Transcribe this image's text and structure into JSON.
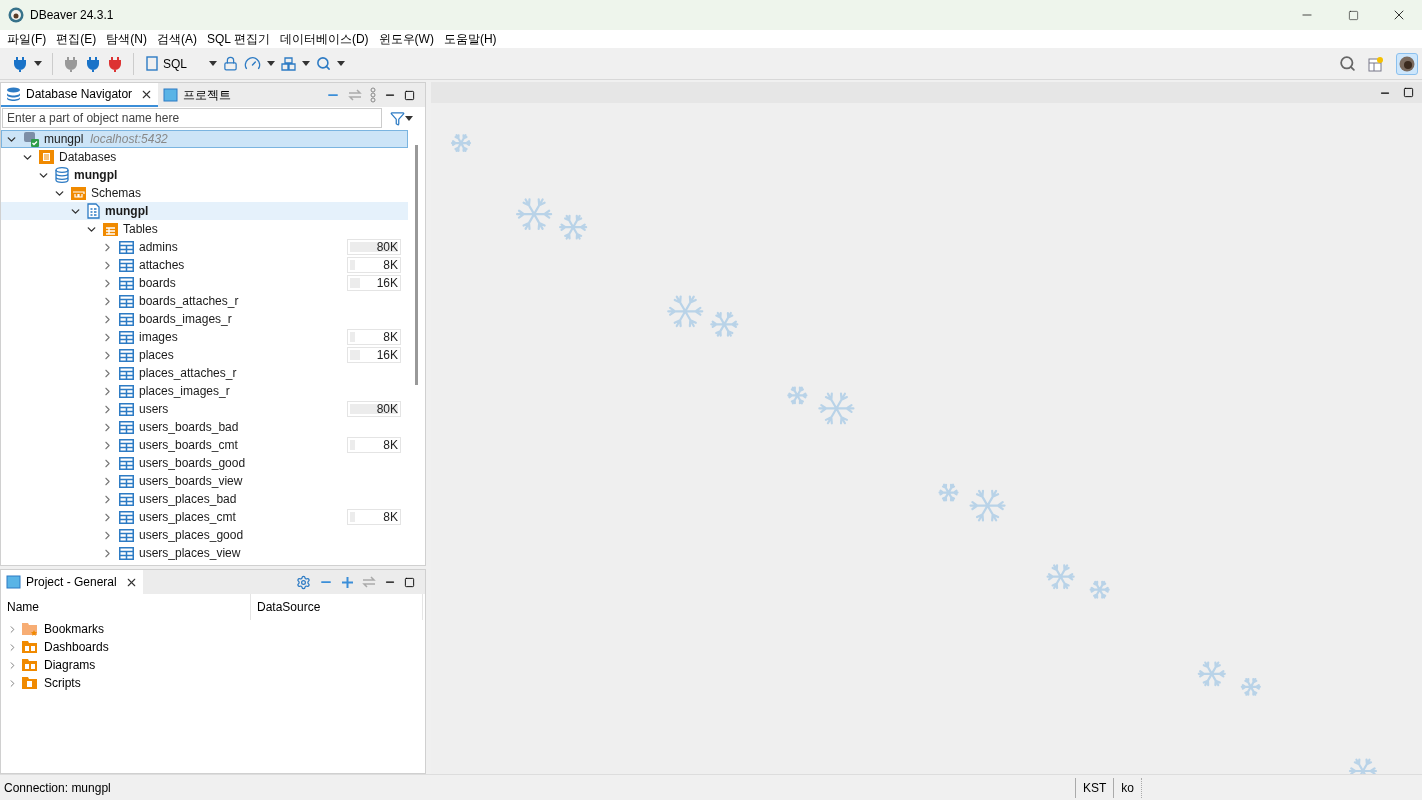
{
  "window": {
    "title": "DBeaver 24.3.1"
  },
  "menu": [
    "파일(F)",
    "편집(E)",
    "탐색(N)",
    "검색(A)",
    "SQL 편집기",
    "데이터베이스(D)",
    "윈도우(W)",
    "도움말(H)"
  ],
  "toolbar": {
    "sql_label": "SQL"
  },
  "navigator": {
    "tabs": [
      {
        "label": "Database Navigator",
        "selected": true
      },
      {
        "label": "프로젝트",
        "selected": false
      }
    ],
    "filter": {
      "placeholder": "Enter a part of object name here"
    },
    "tree": [
      {
        "kind": "connection",
        "label": "mungpl",
        "detail": "localhost:5432",
        "selected": true,
        "hovered": false,
        "expanded": true,
        "children": [
          {
            "kind": "folder",
            "label": "Databases",
            "selected": false,
            "hovered": false,
            "expanded": true,
            "children": [
              {
                "kind": "database",
                "label": "mungpl",
                "selected": false,
                "hovered": false,
                "expanded": true,
                "children": [
                  {
                    "kind": "schemas",
                    "label": "Schemas",
                    "selected": false,
                    "hovered": false,
                    "expanded": true,
                    "children": [
                      {
                        "kind": "schema",
                        "label": "mungpl",
                        "selected": false,
                        "hovered": true,
                        "expanded": true,
                        "children": [
                          {
                            "kind": "tables",
                            "label": "Tables",
                            "selected": false,
                            "hovered": false,
                            "expanded": true,
                            "children": [
                              {
                                "kind": "table",
                                "label": "admins",
                                "size": "80K",
                                "level": 1,
                                "selected": false,
                                "hovered": false,
                                "expanded": false
                              },
                              {
                                "kind": "table",
                                "label": "attaches",
                                "size": "8K",
                                "level": 0.1,
                                "selected": false,
                                "hovered": false,
                                "expanded": false
                              },
                              {
                                "kind": "table",
                                "label": "boards",
                                "size": "16K",
                                "level": 0.2,
                                "selected": false,
                                "hovered": false,
                                "expanded": false
                              },
                              {
                                "kind": "table",
                                "label": "boards_attaches_r",
                                "selected": false,
                                "hovered": false,
                                "expanded": false
                              },
                              {
                                "kind": "table",
                                "label": "boards_images_r",
                                "selected": false,
                                "hovered": false,
                                "expanded": false
                              },
                              {
                                "kind": "table",
                                "label": "images",
                                "size": "8K",
                                "level": 0.1,
                                "selected": false,
                                "hovered": false,
                                "expanded": false
                              },
                              {
                                "kind": "table",
                                "label": "places",
                                "size": "16K",
                                "level": 0.2,
                                "selected": false,
                                "hovered": false,
                                "expanded": false
                              },
                              {
                                "kind": "table",
                                "label": "places_attaches_r",
                                "selected": false,
                                "hovered": false,
                                "expanded": false
                              },
                              {
                                "kind": "table",
                                "label": "places_images_r",
                                "selected": false,
                                "hovered": false,
                                "expanded": false
                              },
                              {
                                "kind": "table",
                                "label": "users",
                                "size": "80K",
                                "level": 1,
                                "selected": false,
                                "hovered": false,
                                "expanded": false
                              },
                              {
                                "kind": "table",
                                "label": "users_boards_bad",
                                "selected": false,
                                "hovered": false,
                                "expanded": false
                              },
                              {
                                "kind": "table",
                                "label": "users_boards_cmt",
                                "size": "8K",
                                "level": 0.1,
                                "selected": false,
                                "hovered": false,
                                "expanded": false
                              },
                              {
                                "kind": "table",
                                "label": "users_boards_good",
                                "selected": false,
                                "hovered": false,
                                "expanded": false
                              },
                              {
                                "kind": "table",
                                "label": "users_boards_view",
                                "selected": false,
                                "hovered": false,
                                "expanded": false
                              },
                              {
                                "kind": "table",
                                "label": "users_places_bad",
                                "selected": false,
                                "hovered": false,
                                "expanded": false
                              },
                              {
                                "kind": "table",
                                "label": "users_places_cmt",
                                "size": "8K",
                                "level": 0.1,
                                "selected": false,
                                "hovered": false,
                                "expanded": false
                              },
                              {
                                "kind": "table",
                                "label": "users_places_good",
                                "selected": false,
                                "hovered": false,
                                "expanded": false
                              },
                              {
                                "kind": "table",
                                "label": "users_places_view",
                                "selected": false,
                                "hovered": false,
                                "expanded": false
                              }
                            ]
                          }
                        ]
                      }
                    ]
                  }
                ]
              }
            ]
          }
        ]
      }
    ]
  },
  "project": {
    "tab": {
      "label": "Project - General",
      "selected": true
    },
    "columns": [
      "Name",
      "DataSource"
    ],
    "items": [
      {
        "kind": "bookmarks",
        "label": "Bookmarks"
      },
      {
        "kind": "dashboards",
        "label": "Dashboards"
      },
      {
        "kind": "diagrams",
        "label": "Diagrams"
      },
      {
        "kind": "scripts",
        "label": "Scripts"
      }
    ]
  },
  "status_bar": {
    "connection": "Connection: mungpl",
    "timezone": "KST",
    "locale": "ko"
  }
}
